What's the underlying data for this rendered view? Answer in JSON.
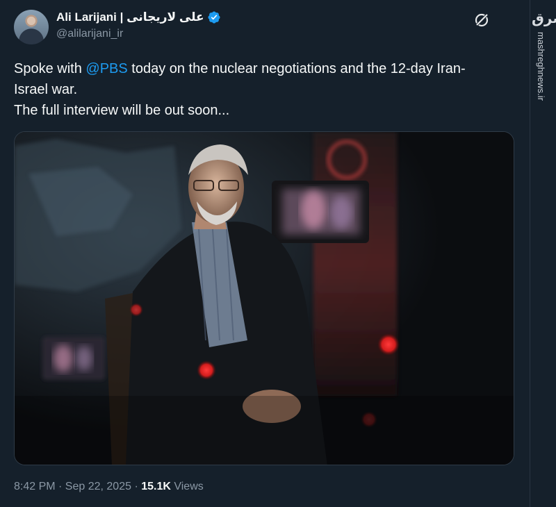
{
  "tweet": {
    "display_name": "Ali Larijani | علی لاریجانی",
    "handle": "@alilarijani_ir",
    "text_parts": {
      "line1_before": "Spoke with ",
      "mention": "@PBS",
      "line1_after": " today on the nuclear negotiations and the 12-day Iran-",
      "line2": "Israel war.",
      "line3": "The full interview will be out soon..."
    },
    "timestamp": "8:42 PM · Sep 22, 2025 · ",
    "views_count": "15.1K",
    "views_label": " Views"
  },
  "watermark": {
    "logo": "مشرق",
    "url": "mashreghnews.ir"
  },
  "colors": {
    "background": "#15202b",
    "text": "#f7f9f9",
    "secondary": "#8b98a5",
    "link": "#1d9bf0",
    "verified": "#1d9bf0"
  },
  "icons": {
    "verified": "verified-badge-icon",
    "grok": "grok-icon"
  }
}
